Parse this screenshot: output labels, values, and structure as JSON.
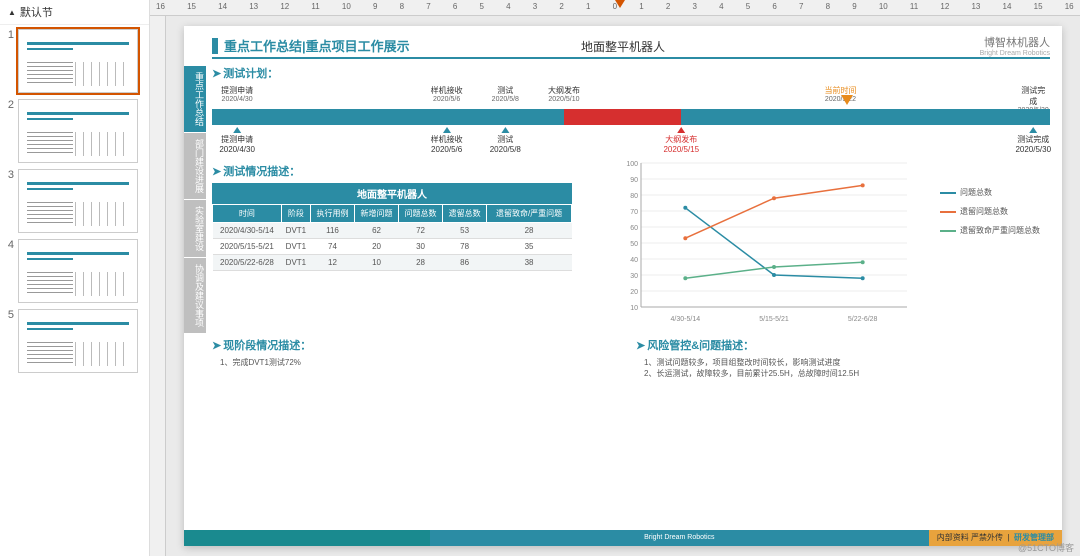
{
  "sidebar": {
    "section_label": "默认节",
    "thumbs": [
      "1",
      "2",
      "3",
      "4",
      "5"
    ]
  },
  "ruler": {
    "ticks": [
      "16",
      "15",
      "14",
      "13",
      "12",
      "11",
      "10",
      "9",
      "8",
      "7",
      "6",
      "5",
      "4",
      "3",
      "2",
      "1",
      "0",
      "1",
      "2",
      "3",
      "4",
      "5",
      "6",
      "7",
      "8",
      "9",
      "10",
      "11",
      "12",
      "13",
      "14",
      "15",
      "16"
    ]
  },
  "slide": {
    "title": "重点工作总结|重点项目工作展示",
    "subtitle": "地面整平机器人",
    "logo_cn": "博智林机器人",
    "logo_en": "Bright Dream Robotics",
    "vtabs": [
      "重点工作总结",
      "部门建设进展",
      "实验室建设",
      "协调及建议事项"
    ],
    "sections": {
      "plan": "测试计划：",
      "desc": "测试情况描述：",
      "status": "现阶段情况描述：",
      "risk": "风险管控&问题描述："
    },
    "timeline_top": [
      {
        "label": "提测申请",
        "date": "2020/4/30",
        "pos": 3
      },
      {
        "label": "样机接收",
        "date": "2020/5/6",
        "pos": 28
      },
      {
        "label": "测试",
        "date": "2020/5/8",
        "pos": 35
      },
      {
        "label": "大纲发布",
        "date": "2020/5/10",
        "pos": 42
      },
      {
        "label": "当前时间",
        "date": "2020/5/22",
        "pos": 75,
        "orange": true
      },
      {
        "label": "测试完成",
        "date": "2020/5/30",
        "pos": 98
      }
    ],
    "timeline_bot": [
      {
        "label": "提测申请",
        "date": "2020/4/30",
        "pos": 3
      },
      {
        "label": "样机接收",
        "date": "2020/5/6",
        "pos": 28
      },
      {
        "label": "测试",
        "date": "2020/5/8",
        "pos": 35
      },
      {
        "label": "大纲发布",
        "date": "2020/5/15",
        "pos": 56,
        "red": true
      },
      {
        "label": "测试完成",
        "date": "2020/5/30",
        "pos": 98
      }
    ],
    "orange_ptr_pos": 75,
    "table": {
      "title": "地面整平机器人",
      "headers": [
        "时间",
        "阶段",
        "执行用例",
        "新增问题",
        "问题总数",
        "遗留总数",
        "遗留致命/严重问题"
      ],
      "rows": [
        [
          "2020/4/30-5/14",
          "DVT1",
          "116",
          "62",
          "72",
          "53",
          "28"
        ],
        [
          "2020/5/15-5/21",
          "DVT1",
          "74",
          "20",
          "30",
          "78",
          "35"
        ],
        [
          "2020/5/22-6/28",
          "DVT1",
          "12",
          "10",
          "28",
          "86",
          "38"
        ]
      ]
    },
    "status_text": "1、完成DVT1测试72%",
    "risk_text1": "1、测试问题较多，项目组整改时间较长，影响测试进度",
    "risk_text2": "2、长运测试，故障较多，目前累计25.5H，总故障时间12.5H",
    "footer_center": "Bright Dream Robotics",
    "footer_right_1": "内部资料  严禁外传",
    "footer_right_2": "研发管理部"
  },
  "chart_data": {
    "type": "line",
    "categories": [
      "4/30-5/14",
      "5/15-5/21",
      "5/22-6/28"
    ],
    "series": [
      {
        "name": "问题总数",
        "values": [
          72,
          30,
          28
        ],
        "color": "#2b8ca4"
      },
      {
        "name": "遗留问题总数",
        "values": [
          53,
          78,
          86
        ],
        "color": "#e8703d"
      },
      {
        "name": "遗留致命严重问题总数",
        "values": [
          28,
          35,
          38
        ],
        "color": "#5bb089"
      }
    ],
    "ylim": [
      10,
      100
    ],
    "yticks": [
      10,
      20,
      30,
      40,
      50,
      60,
      70,
      80,
      90,
      100
    ]
  },
  "watermark": "@51CTO博客"
}
